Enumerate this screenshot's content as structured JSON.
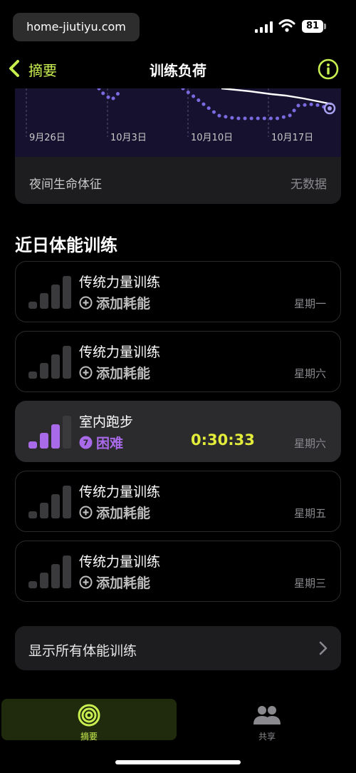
{
  "status_bar": {
    "watermark": "home-jiutiyu.com",
    "battery": "81"
  },
  "nav": {
    "back_label": "摘要",
    "title": "训练负荷"
  },
  "chart": {
    "x_labels": [
      "9月26日",
      "10月3日",
      "10月10日",
      "10月17日"
    ]
  },
  "vitals": {
    "label": "夜间生命体征",
    "value": "无数据"
  },
  "section_title": "近日体能训练",
  "workouts": [
    {
      "name": "传统力量训练",
      "sub": "添加耗能",
      "day": "星期一",
      "time": ""
    },
    {
      "name": "传统力量训练",
      "sub": "添加耗能",
      "day": "星期六",
      "time": ""
    },
    {
      "name": "室内跑步",
      "sub": "困难",
      "effort": "7",
      "day": "星期六",
      "time": "0:30:33"
    },
    {
      "name": "传统力量训练",
      "sub": "添加耗能",
      "day": "星期五",
      "time": ""
    },
    {
      "name": "传统力量训练",
      "sub": "添加耗能",
      "day": "星期三",
      "time": ""
    }
  ],
  "show_all": {
    "label": "显示所有体能训练"
  },
  "tabs": {
    "summary_label": "摘要",
    "share_label": "共享"
  },
  "colors": {
    "accent": "#c8ef50",
    "effort_purple": "#a86ae8",
    "time_yellow": "#e3ec3a",
    "chart_line": "#7a6ae0"
  },
  "icons": [
    "signal-icon",
    "wifi-icon",
    "battery-icon",
    "chevron-left-icon",
    "info-icon",
    "chevron-right-icon",
    "activity-rings-icon",
    "people-icon"
  ]
}
